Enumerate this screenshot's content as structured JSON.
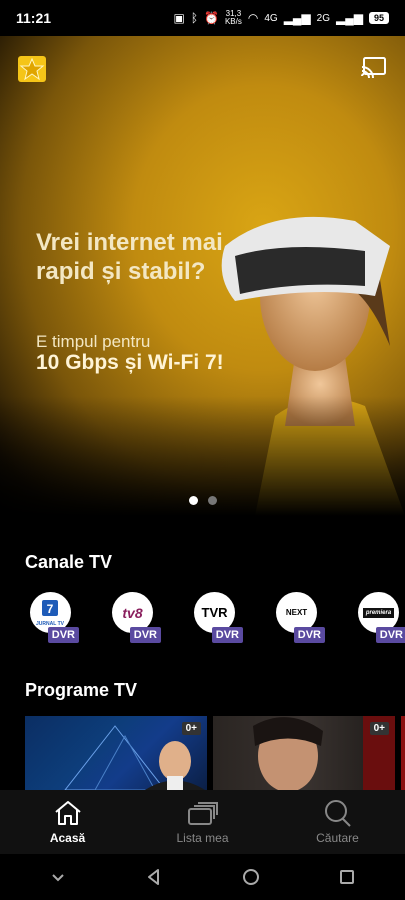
{
  "status": {
    "time": "11:21",
    "net_speed_top": "31,3",
    "net_speed_unit": "KB/s",
    "network1": "4G",
    "network2": "2G",
    "battery": "95"
  },
  "hero": {
    "headline": "Vrei internet mai rapid și stabil?",
    "sub": "E timpul pentru",
    "sub2": "10 Gbps și Wi-Fi 7!",
    "pages": 2,
    "active_page": 1
  },
  "channels_section": {
    "title": "Canale TV",
    "items": [
      {
        "name": "Jurnal TV",
        "logo_text": "7",
        "logo_caption": "JURNAL TV",
        "badge": "DVR"
      },
      {
        "name": "TV8",
        "logo_text": "tv8",
        "badge": "DVR"
      },
      {
        "name": "TVR",
        "logo_text": "TVR",
        "badge": "DVR"
      },
      {
        "name": "Next TV",
        "logo_text": "NEXT",
        "badge": "DVR"
      },
      {
        "name": "Premiera",
        "logo_text": "premiera",
        "badge": "DVR"
      }
    ]
  },
  "programs_section": {
    "title": "Programe TV",
    "items": [
      {
        "age": "0+"
      },
      {
        "age": "0+"
      }
    ]
  },
  "nav": {
    "home": "Acasă",
    "mylist": "Lista mea",
    "search": "Căutare"
  },
  "colors": {
    "accent_yellow": "#f5c518",
    "dvr_badge": "#5a4aa0"
  }
}
